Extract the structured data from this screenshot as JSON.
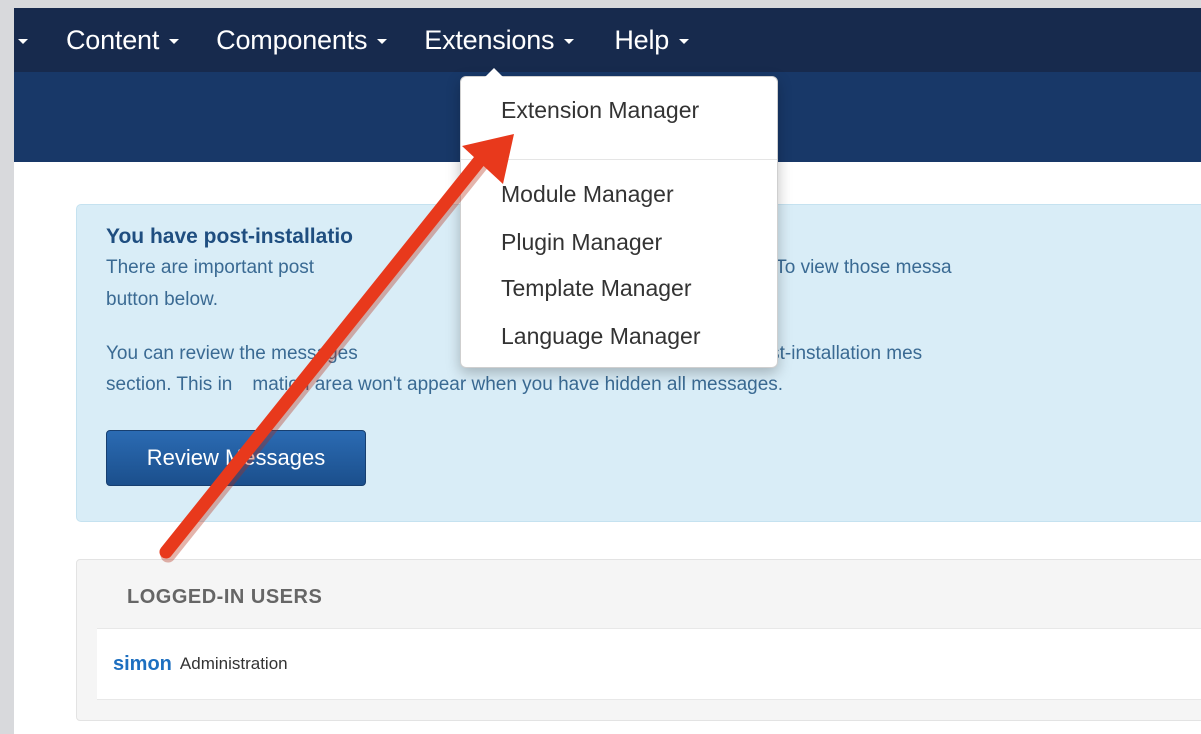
{
  "navbar": {
    "items": [
      {
        "label": "Content"
      },
      {
        "label": "Components"
      },
      {
        "label": "Extensions"
      },
      {
        "label": "Help"
      }
    ]
  },
  "dropdown": {
    "items": [
      {
        "label": "Extension Manager"
      },
      {
        "label": "Module Manager"
      },
      {
        "label": "Plugin Manager"
      },
      {
        "label": "Template Manager"
      },
      {
        "label": "Language Manager"
      }
    ]
  },
  "alert": {
    "title": "You have post-installatio",
    "line1": "There are important post",
    "line1_tail": "e your attention. To view those messa",
    "line2": "button below.",
    "line3_head": "You can review the",
    "line3_mid": "messages",
    "line3_tail": "e Components, Post-installation mes",
    "line4_head": "section. This in",
    "line4_tail": "mation area won't appear when you have hidden all messages.",
    "button_label": "Review Messages"
  },
  "panel": {
    "header": "LOGGED-IN USERS",
    "rows": [
      {
        "user": "simon",
        "role": "Administration"
      }
    ]
  },
  "colors": {
    "navbar": "#172a4d",
    "subheader": "#183868",
    "alert_bg": "#d9edf7",
    "button": "#1b4f8c",
    "annotation_arrow": "#e8391c"
  }
}
